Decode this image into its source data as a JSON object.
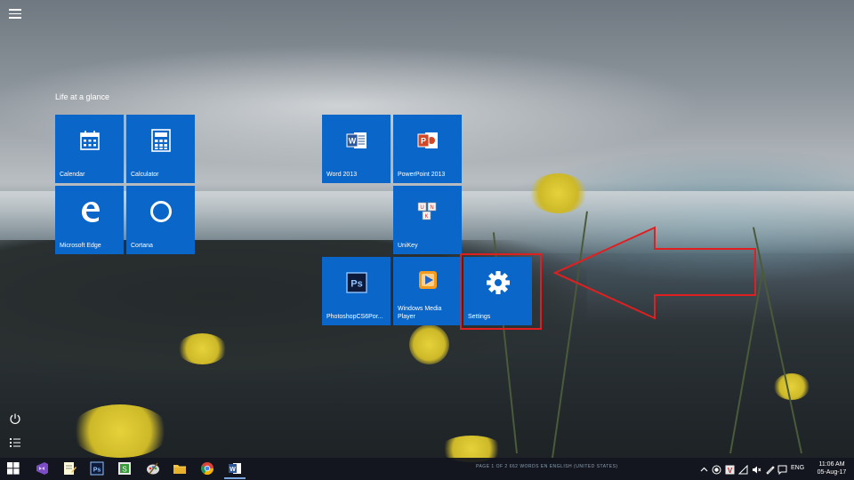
{
  "start_menu": {
    "group_title": "Life at a glance",
    "tiles": [
      {
        "label": "Calendar",
        "icon": "calendar-icon"
      },
      {
        "label": "Calculator",
        "icon": "calculator-icon"
      },
      {
        "label": "Microsoft Edge",
        "icon": "edge-icon"
      },
      {
        "label": "Cortana",
        "icon": "cortana-icon"
      },
      {
        "label": "Word 2013",
        "icon": "word-icon"
      },
      {
        "label": "PowerPoint 2013",
        "icon": "powerpoint-icon"
      },
      {
        "label": "UniKey",
        "icon": "unikey-icon"
      },
      {
        "label": "PhotoshopCS6Por...",
        "icon": "photoshop-icon"
      },
      {
        "label": "Windows Media Player",
        "icon": "media-player-icon"
      },
      {
        "label": "Settings",
        "icon": "gear-icon"
      }
    ]
  },
  "colors": {
    "tile_bg": "#0a67c9",
    "highlight": "#e02020",
    "taskbar_bg": "#12161e"
  },
  "taskbar": {
    "pinned": [
      "windows-logo-icon",
      "visual-studio-icon",
      "notepad-icon",
      "photoshop-icon",
      "snagit-icon",
      "paint-icon",
      "file-explorer-icon",
      "chrome-icon",
      "word-icon"
    ],
    "status_text": "PAGE 1 OF 2    662 WORDS    EN    ENGLISH (UNITED STATES)",
    "language": "ENG",
    "time": "11:06 AM",
    "date": "05-Aug-17"
  }
}
